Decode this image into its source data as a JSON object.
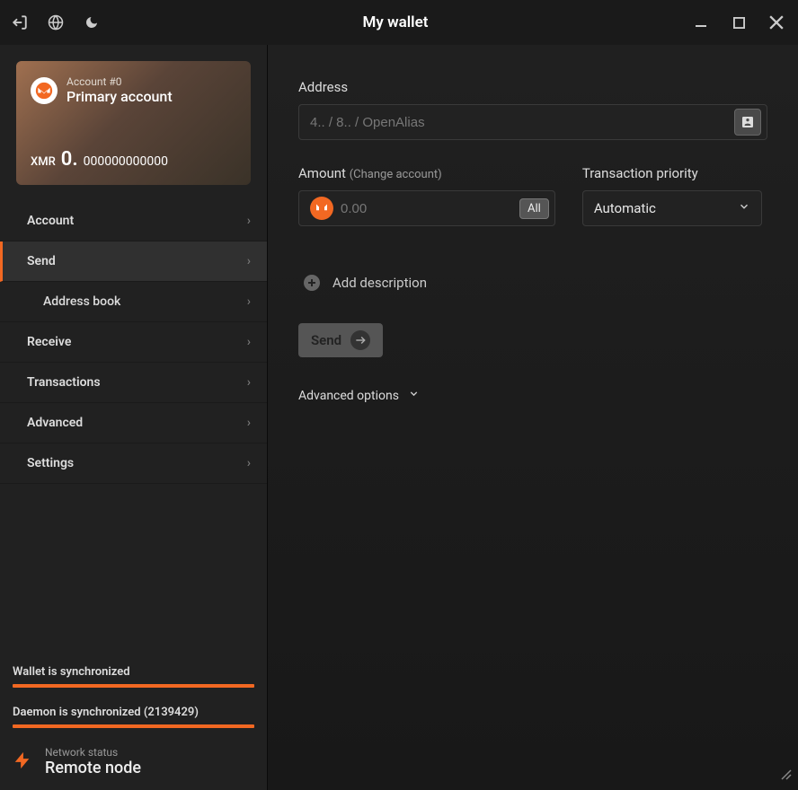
{
  "title": "My wallet",
  "account_card": {
    "subtitle": "Account #0",
    "name": "Primary account",
    "currency": "XMR",
    "balance_int": "0.",
    "balance_dec": "000000000000"
  },
  "nav": {
    "account": "Account",
    "send": "Send",
    "address_book": "Address book",
    "receive": "Receive",
    "transactions": "Transactions",
    "advanced": "Advanced",
    "settings": "Settings"
  },
  "sync": {
    "wallet_label": "Wallet is synchronized",
    "daemon_label": "Daemon is synchronized (2139429)"
  },
  "network": {
    "label": "Network status",
    "value": "Remote node"
  },
  "send_form": {
    "address_label": "Address",
    "address_placeholder": "4.. / 8.. / OpenAlias",
    "amount_label": "Amount",
    "amount_sub": "(Change account)",
    "amount_placeholder": "0.00",
    "all_button": "All",
    "priority_label": "Transaction priority",
    "priority_value": "Automatic",
    "add_description": "Add description",
    "send_button": "Send",
    "advanced_options": "Advanced options"
  }
}
